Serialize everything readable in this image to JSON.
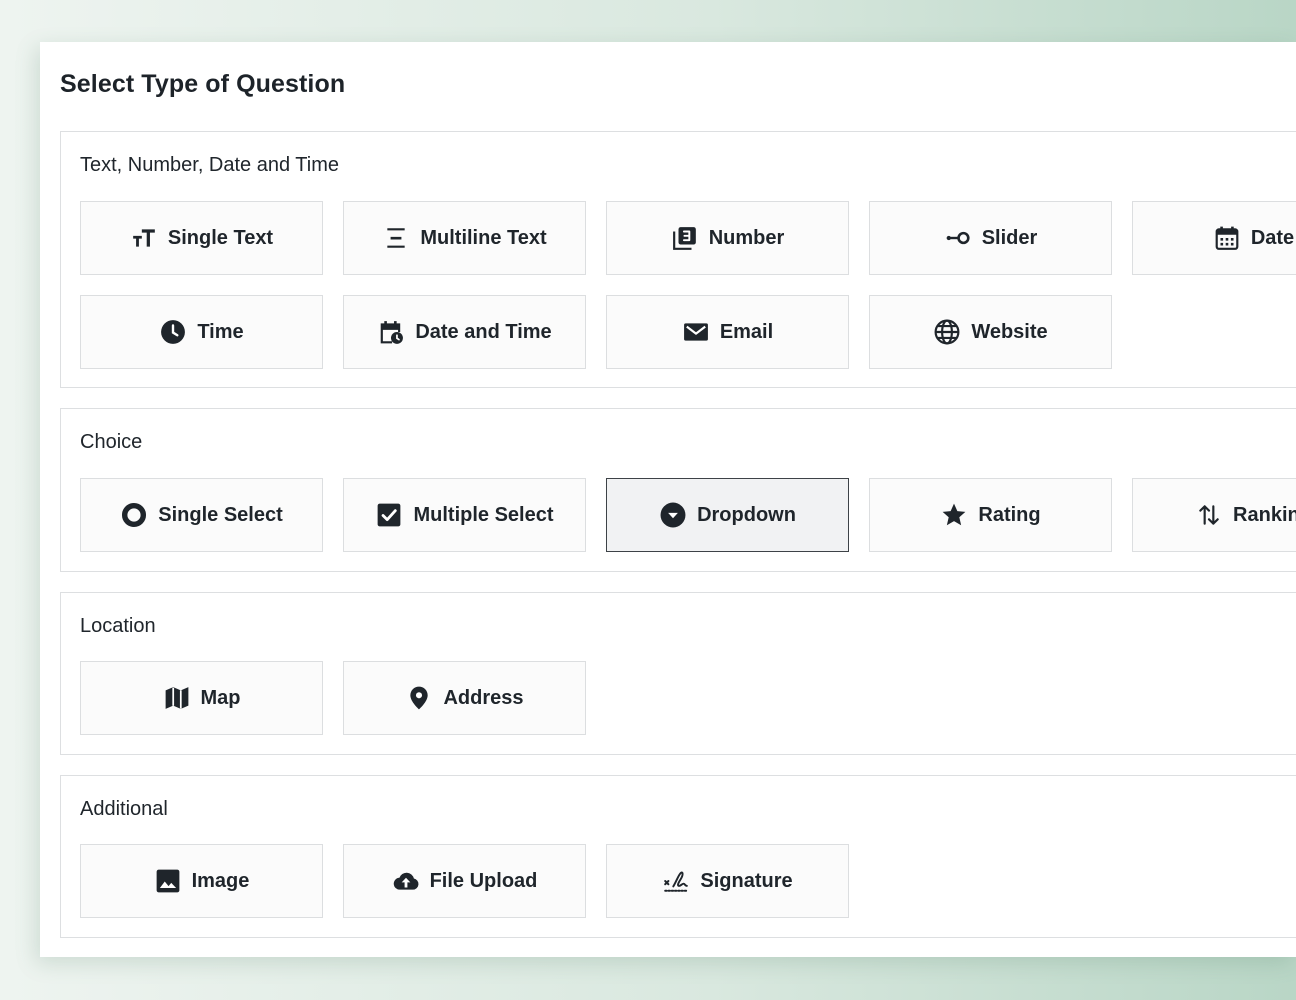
{
  "dialog": {
    "title": "Select Type of Question"
  },
  "sections": {
    "text": {
      "title": "Text, Number, Date and Time",
      "items": [
        {
          "label": "Single Text",
          "icon": "text-size-icon"
        },
        {
          "label": "Multiline Text",
          "icon": "multiline-text-icon"
        },
        {
          "label": "Number",
          "icon": "number-icon"
        },
        {
          "label": "Slider",
          "icon": "slider-icon"
        },
        {
          "label": "Date",
          "icon": "calendar-icon"
        },
        {
          "label": "Time",
          "icon": "clock-icon"
        },
        {
          "label": "Date and Time",
          "icon": "calendar-clock-icon"
        },
        {
          "label": "Email",
          "icon": "envelope-icon"
        },
        {
          "label": "Website",
          "icon": "globe-icon"
        }
      ]
    },
    "choice": {
      "title": "Choice",
      "items": [
        {
          "label": "Single Select",
          "icon": "radio-icon"
        },
        {
          "label": "Multiple Select",
          "icon": "checkbox-icon"
        },
        {
          "label": "Dropdown",
          "icon": "dropdown-icon",
          "selected": true
        },
        {
          "label": "Rating",
          "icon": "star-icon"
        },
        {
          "label": "Ranking",
          "icon": "ranking-arrows-icon"
        }
      ]
    },
    "location": {
      "title": "Location",
      "items": [
        {
          "label": "Map",
          "icon": "map-icon"
        },
        {
          "label": "Address",
          "icon": "location-pin-icon"
        }
      ]
    },
    "additional": {
      "title": "Additional",
      "items": [
        {
          "label": "Image",
          "icon": "image-icon"
        },
        {
          "label": "File Upload",
          "icon": "cloud-upload-icon"
        },
        {
          "label": "Signature",
          "icon": "signature-icon"
        }
      ]
    }
  },
  "colors": {
    "text": "#1f252b",
    "tile_border": "#dcdee0",
    "tile_bg": "#fbfbfb",
    "selected_border": "#3d4247"
  }
}
